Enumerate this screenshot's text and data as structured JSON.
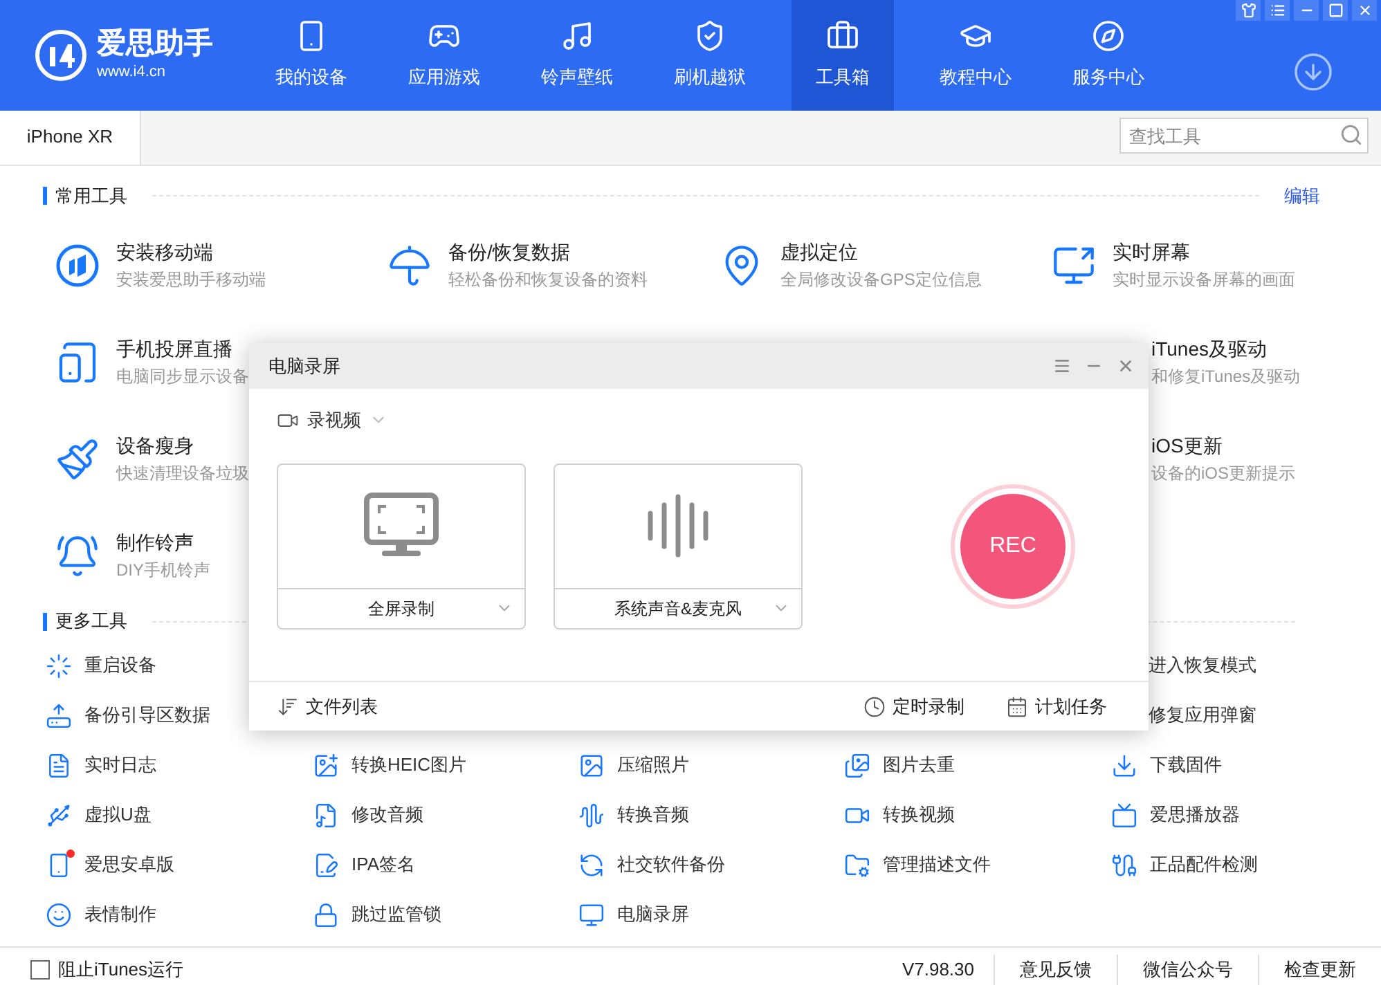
{
  "app": {
    "name": "爱思助手",
    "url": "www.i4.cn"
  },
  "nav": [
    {
      "label": "我的设备",
      "selected": false
    },
    {
      "label": "应用游戏",
      "selected": false
    },
    {
      "label": "铃声壁纸",
      "selected": false
    },
    {
      "label": "刷机越狱",
      "selected": false
    },
    {
      "label": "工具箱",
      "selected": true
    },
    {
      "label": "教程中心",
      "selected": false
    },
    {
      "label": "服务中心",
      "selected": false
    }
  ],
  "tabs": [
    {
      "label": "iPhone XR",
      "selected": true
    }
  ],
  "search": {
    "placeholder": "查找工具"
  },
  "common_tools": {
    "title": "常用工具",
    "edit": "编辑",
    "items": [
      {
        "kind": "tool",
        "title": "安装移动端",
        "desc": "安装爱思助手移动端"
      },
      {
        "kind": "tool",
        "title": "备份/恢复数据",
        "desc": "轻松备份和恢复设备的资料"
      },
      {
        "kind": "tool",
        "title": "虚拟定位",
        "desc": "全局修改设备GPS定位信息"
      },
      {
        "kind": "tool",
        "title": "实时屏幕",
        "desc": "实时显示设备屏幕的画面"
      },
      {
        "kind": "tool",
        "title": "手机投屏直播",
        "desc": "电脑同步显示设备"
      },
      {
        "kind": "clipped",
        "title": "iTunes及驱动",
        "desc": "和修复iTunes及驱动"
      },
      {
        "kind": "tool",
        "title": "设备瘦身",
        "desc": "快速清理设备垃圾"
      },
      {
        "kind": "clipped",
        "title": "iOS更新",
        "desc": "设备的iOS更新提示"
      },
      {
        "kind": "tool",
        "title": "制作铃声",
        "desc": "DIY手机铃声"
      }
    ]
  },
  "more_tools": {
    "title": "更多工具",
    "items": [
      {
        "kind": "tool",
        "label": "重启设备",
        "dot": false
      },
      {
        "kind": "clipped",
        "label": "进入恢复模式"
      },
      {
        "kind": "tool",
        "label": "备份引导区数据",
        "dot": false
      },
      {
        "kind": "clipped",
        "label": "修复应用弹窗"
      },
      {
        "kind": "tool",
        "label": "实时日志",
        "dot": false
      },
      {
        "kind": "tool",
        "label": "转换HEIC图片",
        "dot": false
      },
      {
        "kind": "tool",
        "label": "压缩照片",
        "dot": false
      },
      {
        "kind": "tool",
        "label": "图片去重",
        "dot": false
      },
      {
        "kind": "tool",
        "label": "下载固件",
        "dot": false
      },
      {
        "kind": "tool",
        "label": "虚拟U盘",
        "dot": false
      },
      {
        "kind": "tool",
        "label": "修改音频",
        "dot": false
      },
      {
        "kind": "tool",
        "label": "转换音频",
        "dot": false
      },
      {
        "kind": "tool",
        "label": "转换视频",
        "dot": false
      },
      {
        "kind": "tool",
        "label": "爱思播放器",
        "dot": false
      },
      {
        "kind": "tool",
        "label": "爱思安卓版",
        "dot": true
      },
      {
        "kind": "tool",
        "label": "IPA签名",
        "dot": false
      },
      {
        "kind": "tool",
        "label": "社交软件备份",
        "dot": false
      },
      {
        "kind": "tool",
        "label": "管理描述文件",
        "dot": false
      },
      {
        "kind": "tool",
        "label": "正品配件检测",
        "dot": false
      },
      {
        "kind": "tool",
        "label": "表情制作",
        "dot": false
      },
      {
        "kind": "tool",
        "label": "跳过监管锁",
        "dot": false
      },
      {
        "kind": "tool",
        "label": "电脑录屏",
        "dot": false
      }
    ]
  },
  "dialog": {
    "title": "电脑录屏",
    "mode": "录视频",
    "sources": [
      {
        "kind": "screen",
        "label": "全屏录制"
      },
      {
        "kind": "audio",
        "label": "系统声音&麦克风"
      }
    ],
    "rec": "REC",
    "file_list": "文件列表",
    "timer": "定时录制",
    "schedule": "计划任务"
  },
  "status_bar": {
    "checkbox": {
      "label": "阻止iTunes运行",
      "checked": false
    },
    "version": "V7.98.30",
    "links": [
      "意见反馈",
      "微信公众号",
      "检查更新"
    ]
  }
}
